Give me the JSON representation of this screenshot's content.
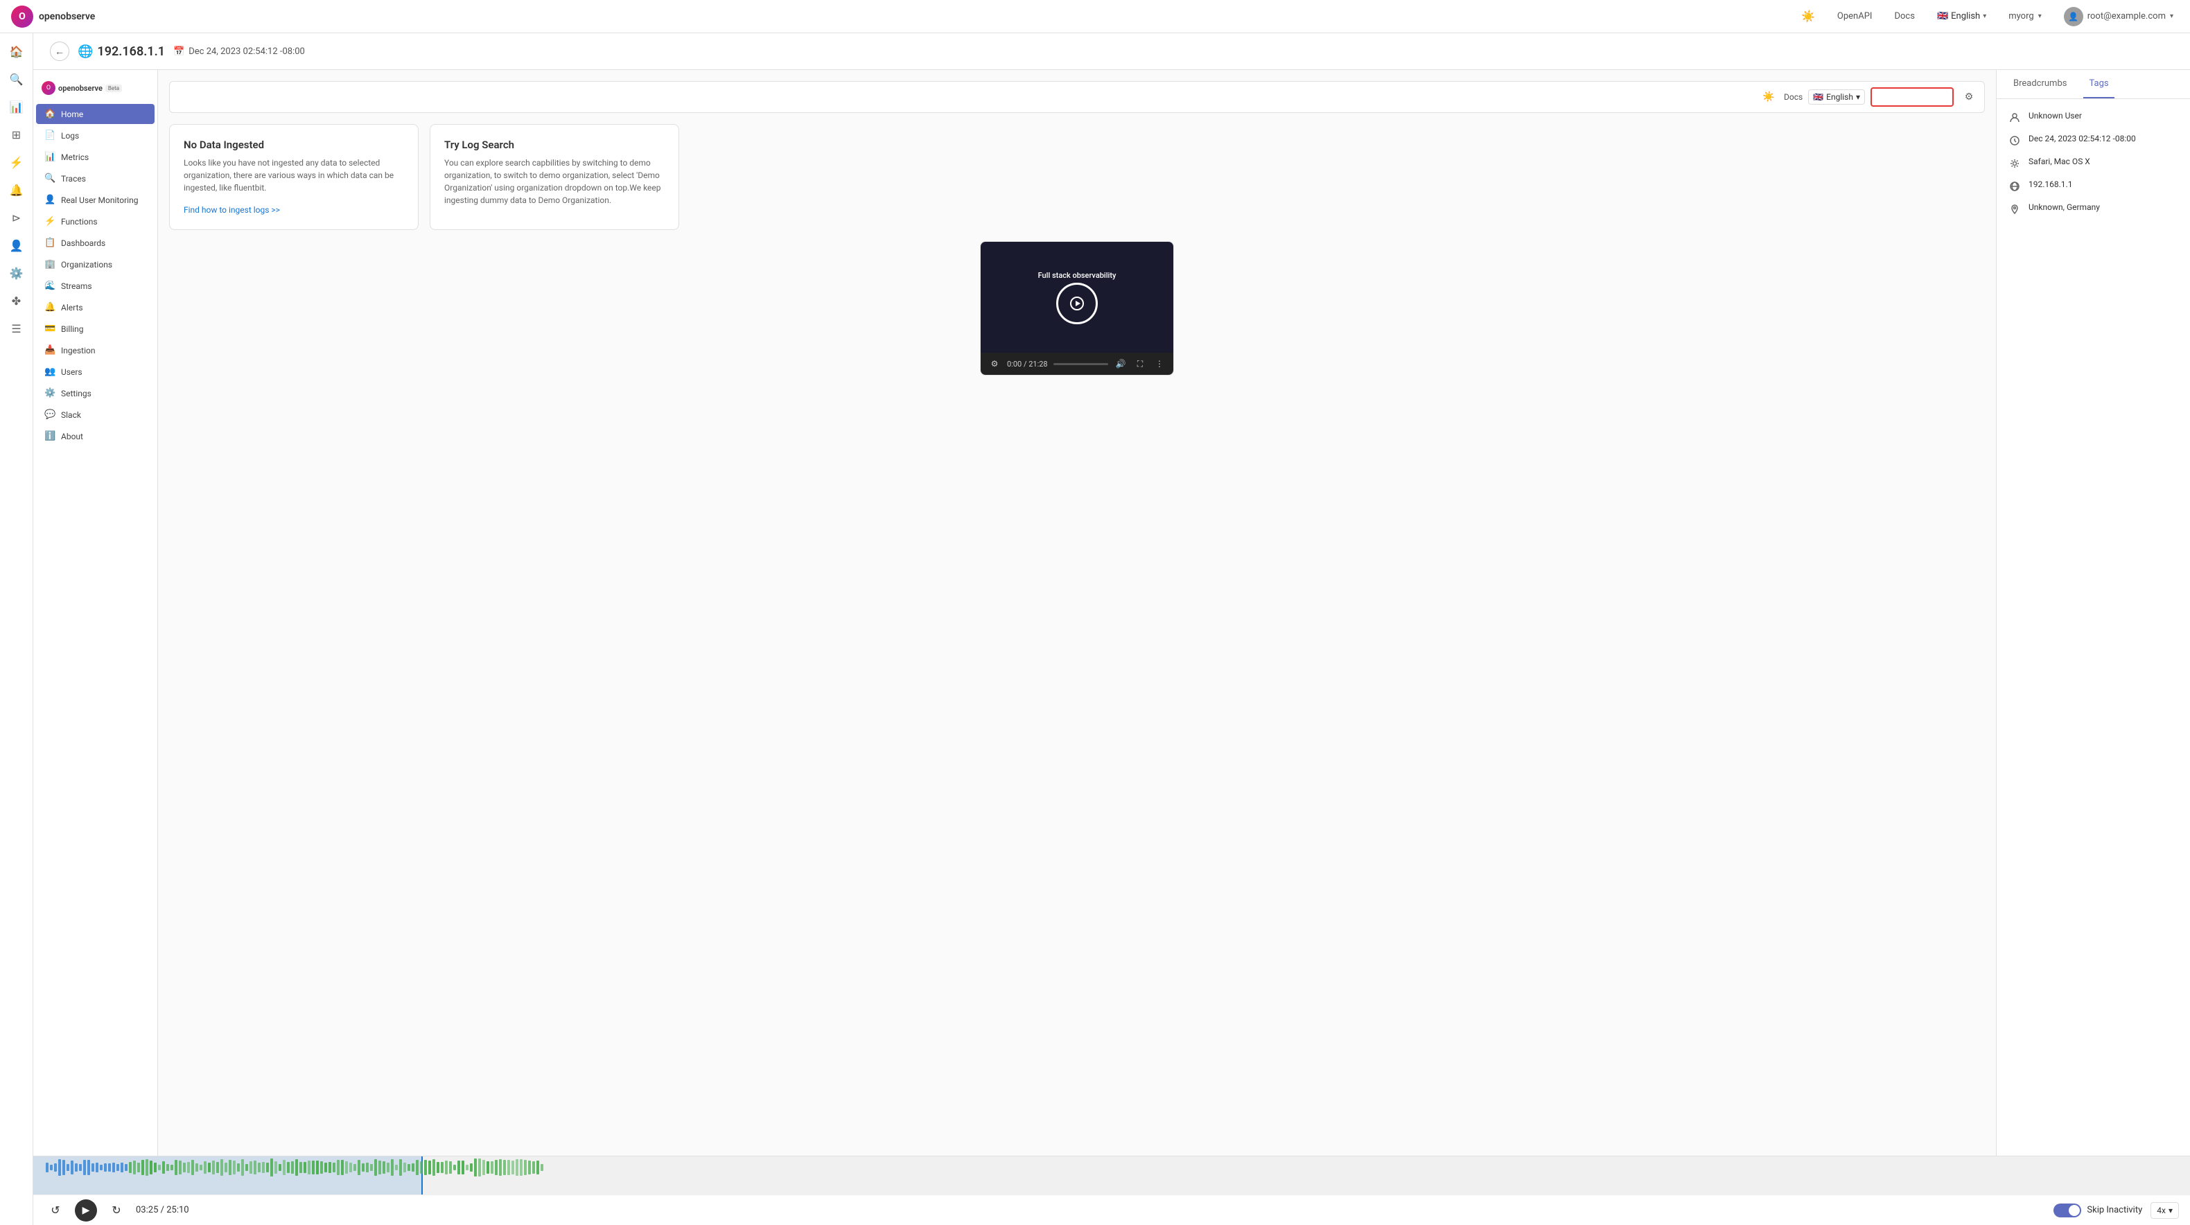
{
  "navbar": {
    "logo_text": "openobserve",
    "openapi_label": "OpenAPI",
    "docs_label": "Docs",
    "lang_label": "English",
    "org_label": "myorg",
    "user_email": "root@example.com"
  },
  "top_bar": {
    "ip_address": "192.168.1.1",
    "date_time": "Dec 24, 2023 02:54:12 -08:00"
  },
  "left_nav": {
    "logo_text": "openobserve",
    "beta_label": "Beta",
    "items": [
      {
        "label": "Home",
        "icon": "🏠",
        "active": true
      },
      {
        "label": "Logs",
        "icon": "📄"
      },
      {
        "label": "Metrics",
        "icon": "📊"
      },
      {
        "label": "Traces",
        "icon": "🔍"
      },
      {
        "label": "Real User Monitoring",
        "icon": "👤"
      },
      {
        "label": "Functions",
        "icon": "⚡"
      },
      {
        "label": "Dashboards",
        "icon": "📋"
      },
      {
        "label": "Organizations",
        "icon": "🏢"
      },
      {
        "label": "Streams",
        "icon": "🌊"
      },
      {
        "label": "Alerts",
        "icon": "🔔"
      },
      {
        "label": "Billing",
        "icon": "💳"
      },
      {
        "label": "Ingestion",
        "icon": "📥"
      },
      {
        "label": "Users",
        "icon": "👥"
      },
      {
        "label": "Settings",
        "icon": "⚙️"
      },
      {
        "label": "Slack",
        "icon": "💬"
      },
      {
        "label": "About",
        "icon": "ℹ️"
      }
    ]
  },
  "settings_bar": {
    "docs_label": "Docs",
    "lang_label": "English",
    "org_placeholder": ""
  },
  "cards": [
    {
      "title": "No Data Ingested",
      "body": "Looks like you have not ingested any data to selected organization, there are various ways in which data can be ingested, like fluentbit.",
      "link": "Find how to ingest logs >>"
    },
    {
      "title": "Try Log Search",
      "body": "You can explore search capbilities by switching to demo organization, to switch to demo organization, select 'Demo Organization' using organization dropdown on top.We keep ingesting dummy data to Demo Organization.",
      "link": ""
    }
  ],
  "video": {
    "title": "Full stack observability",
    "time_current": "0:00",
    "time_total": "21:28"
  },
  "right_panel": {
    "tabs": [
      {
        "label": "Breadcrumbs",
        "active": false
      },
      {
        "label": "Tags",
        "active": true
      }
    ],
    "info_items": [
      {
        "icon": "user",
        "text": "Unknown User"
      },
      {
        "icon": "clock",
        "text": "Dec 24, 2023 02:54:12 -08:00"
      },
      {
        "icon": "gear",
        "text": "Safari, Mac OS X"
      },
      {
        "icon": "globe",
        "text": "192.168.1.1"
      },
      {
        "icon": "location",
        "text": "Unknown, Germany"
      }
    ]
  },
  "player": {
    "time_current": "03:25",
    "time_total": "25:10",
    "skip_label": "Skip Inactivity",
    "speed_label": "4x"
  }
}
